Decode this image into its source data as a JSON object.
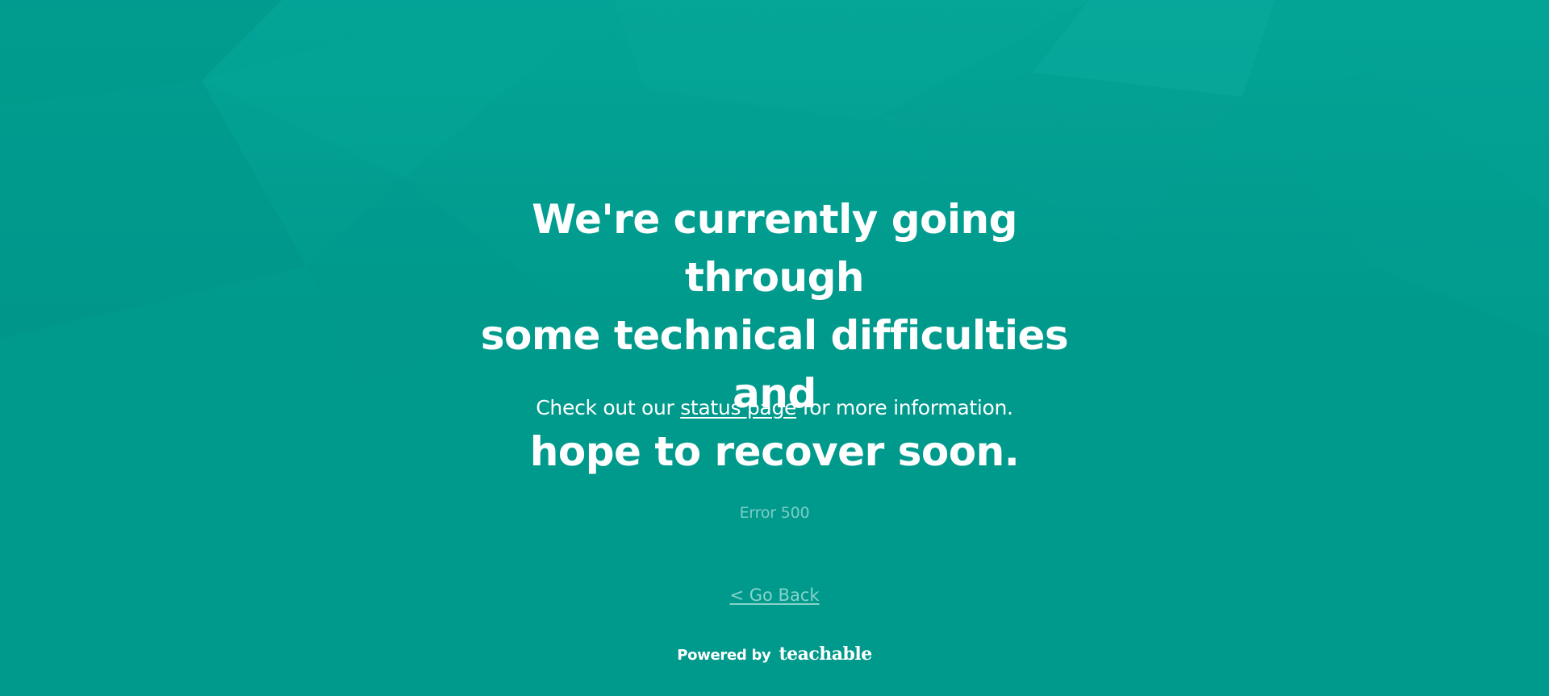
{
  "page": {
    "background_color": "#009b8c",
    "headline_lines": [
      "We're currently going through",
      "some technical difficulties and",
      "hope to recover soon."
    ],
    "subline": {
      "prefix": "Check out our ",
      "link_text": "status page",
      "suffix": " for more information."
    },
    "error_label": "Error 500",
    "go_back_label": "< Go Back",
    "footer": {
      "powered_by": "Powered by",
      "brand": "teachable"
    }
  },
  "colors": {
    "background": "#009b8c",
    "text": "#ffffff",
    "muted_text": "#7ccec6",
    "link_muted": "#86d3cb"
  }
}
